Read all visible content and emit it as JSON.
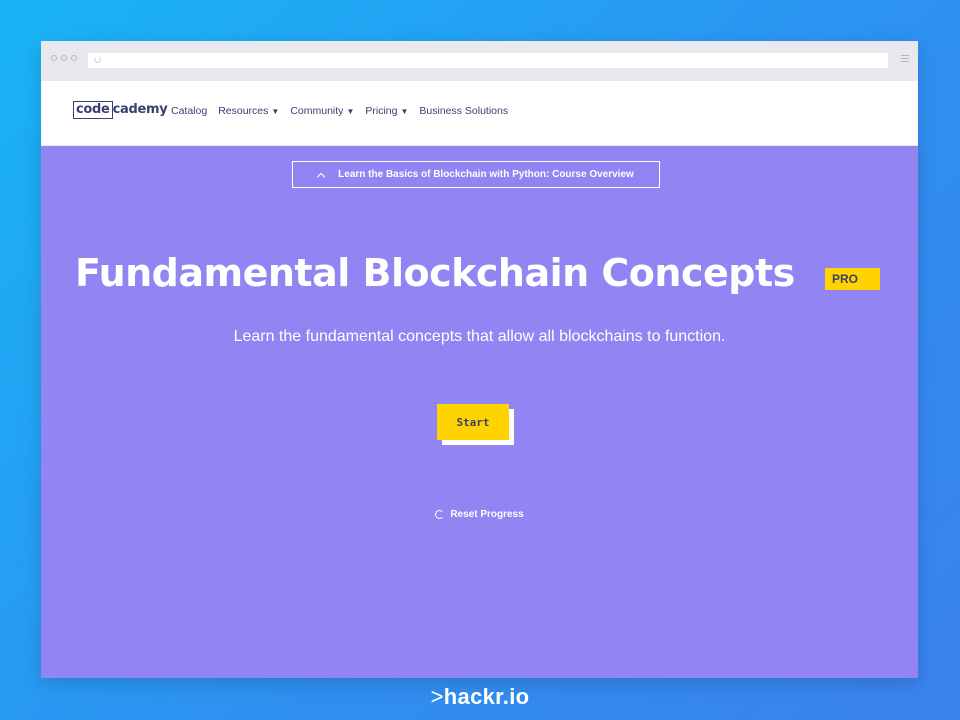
{
  "browser": {
    "url": ""
  },
  "nav": {
    "logo_boxed": "code",
    "logo_rest": "cademy",
    "items": [
      {
        "label": "Catalog",
        "caret": ""
      },
      {
        "label": "Resources",
        "caret": "▼"
      },
      {
        "label": "Community",
        "caret": "▼"
      },
      {
        "label": "Pricing",
        "caret": "▼"
      },
      {
        "label": "Business Solutions",
        "caret": ""
      }
    ]
  },
  "hero": {
    "overview_link": "Learn the Basics of Blockchain with Python: Course Overview",
    "title": "Fundamental Blockchain Concepts",
    "badge": "PRO",
    "subtitle": "Learn the fundamental concepts that allow all blockchains to function.",
    "start_label": "Start",
    "reset_label": "Reset Progress"
  },
  "footer": {
    "brand_prefix": ">",
    "brand_text": "hackr.io"
  },
  "colors": {
    "hero_bg": "#9085f2",
    "accent_yellow": "#ffd300",
    "brand_navy": "#3b3f6e"
  }
}
